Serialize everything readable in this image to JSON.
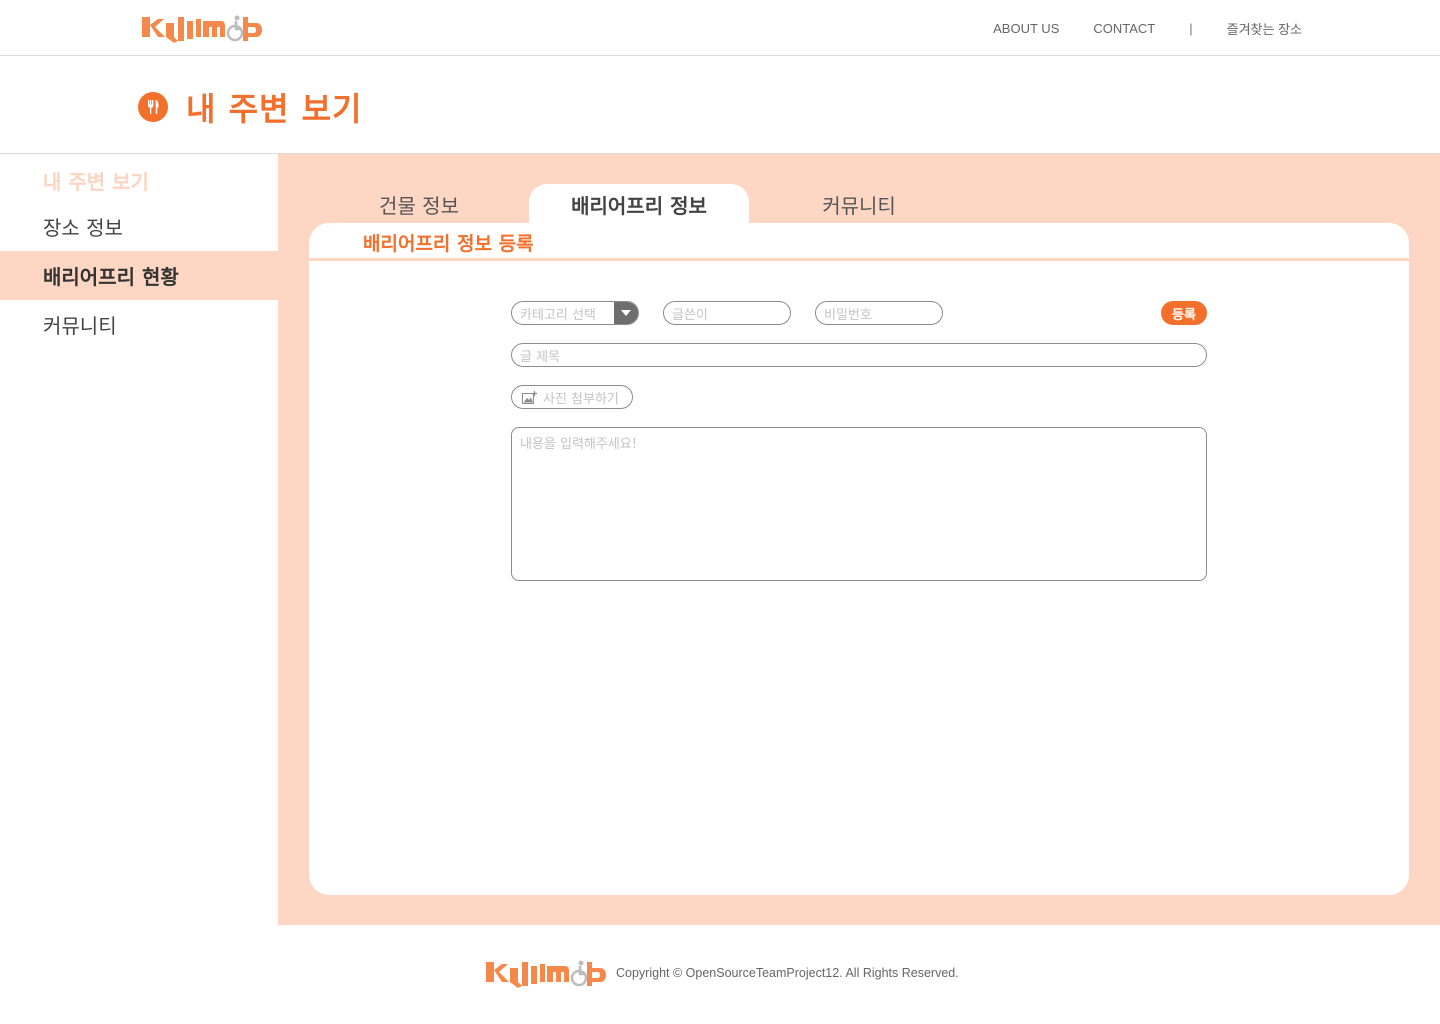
{
  "header": {
    "logo_alt": "logo",
    "nav": {
      "about": "ABOUT US",
      "contact": "CONTACT",
      "separator": "|",
      "favorites": "즐겨찾는 장소"
    }
  },
  "page": {
    "title": "내 주변 보기",
    "title_icon": "fork-knife-icon"
  },
  "sidebar": {
    "heading": "내 주변 보기",
    "items": [
      {
        "label": "장소 정보",
        "active": false
      },
      {
        "label": "배리어프리 현황",
        "active": true
      },
      {
        "label": "커뮤니티",
        "active": false
      }
    ]
  },
  "tabs": [
    {
      "label": "건물 정보",
      "active": false
    },
    {
      "label": "배리어프리 정보",
      "active": true
    },
    {
      "label": "커뮤니티",
      "active": false
    }
  ],
  "form": {
    "title": "배리어프리 정보 등록",
    "category_placeholder": "카테고리 선택",
    "author_placeholder": "글쓴이",
    "password_placeholder": "비밀번호",
    "submit_label": "등록",
    "subject_placeholder": "글 제목",
    "attach_label": "사진 첨부하기",
    "content_placeholder": "내용을 입력해주세요!"
  },
  "footer": {
    "copyright": "Copyright © OpenSourceTeamProject12. All Rights Reserved."
  },
  "colors": {
    "accent": "#f26f2c",
    "panel": "#fed6c4",
    "sidebar_active": "#fdd7c4"
  }
}
